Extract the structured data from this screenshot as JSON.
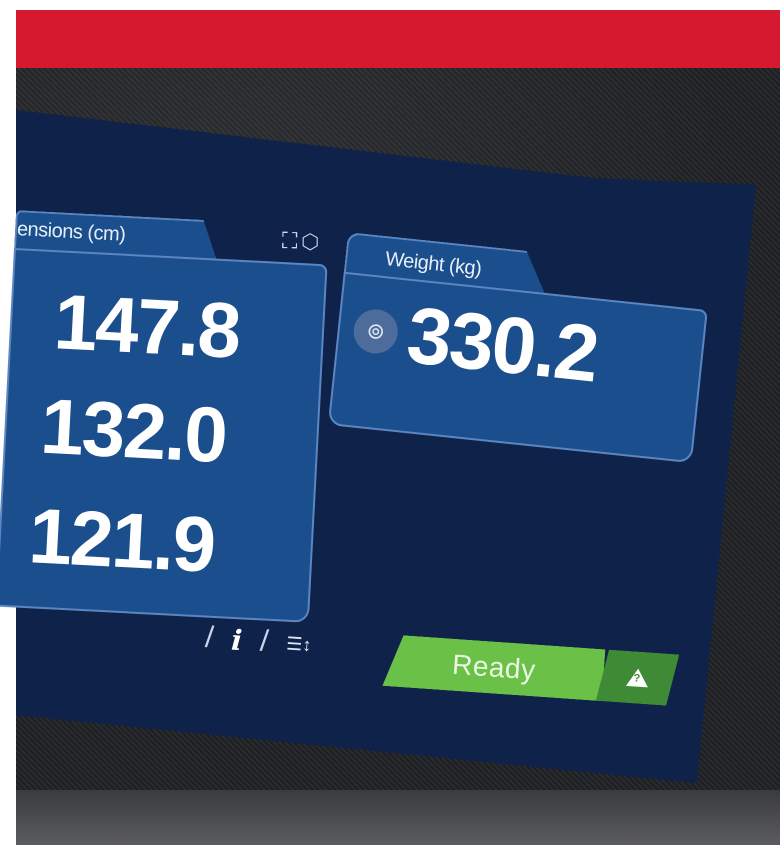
{
  "dimensions_panel": {
    "label": "ensions (cm)",
    "values": [
      "147.8",
      "132.0",
      "121.9"
    ],
    "icons": [
      "frame-icon",
      "hexagon-icon"
    ]
  },
  "weight_panel": {
    "label": "Weight (kg)",
    "value": "330.2",
    "icon": "scale-icon"
  },
  "toolbar": {
    "info_icon": "info-icon",
    "list_icon": "list-sort-icon"
  },
  "status": {
    "label": "Ready",
    "alert_icon": "warning-triangle-icon"
  },
  "colors": {
    "screen_bg": "#0f2249",
    "panel_bg": "#1b4e8c",
    "panel_border": "#5b86c1",
    "status_green": "#6bc047",
    "status_dark_green": "#3f8a35",
    "brand_red": "#d7192f"
  }
}
